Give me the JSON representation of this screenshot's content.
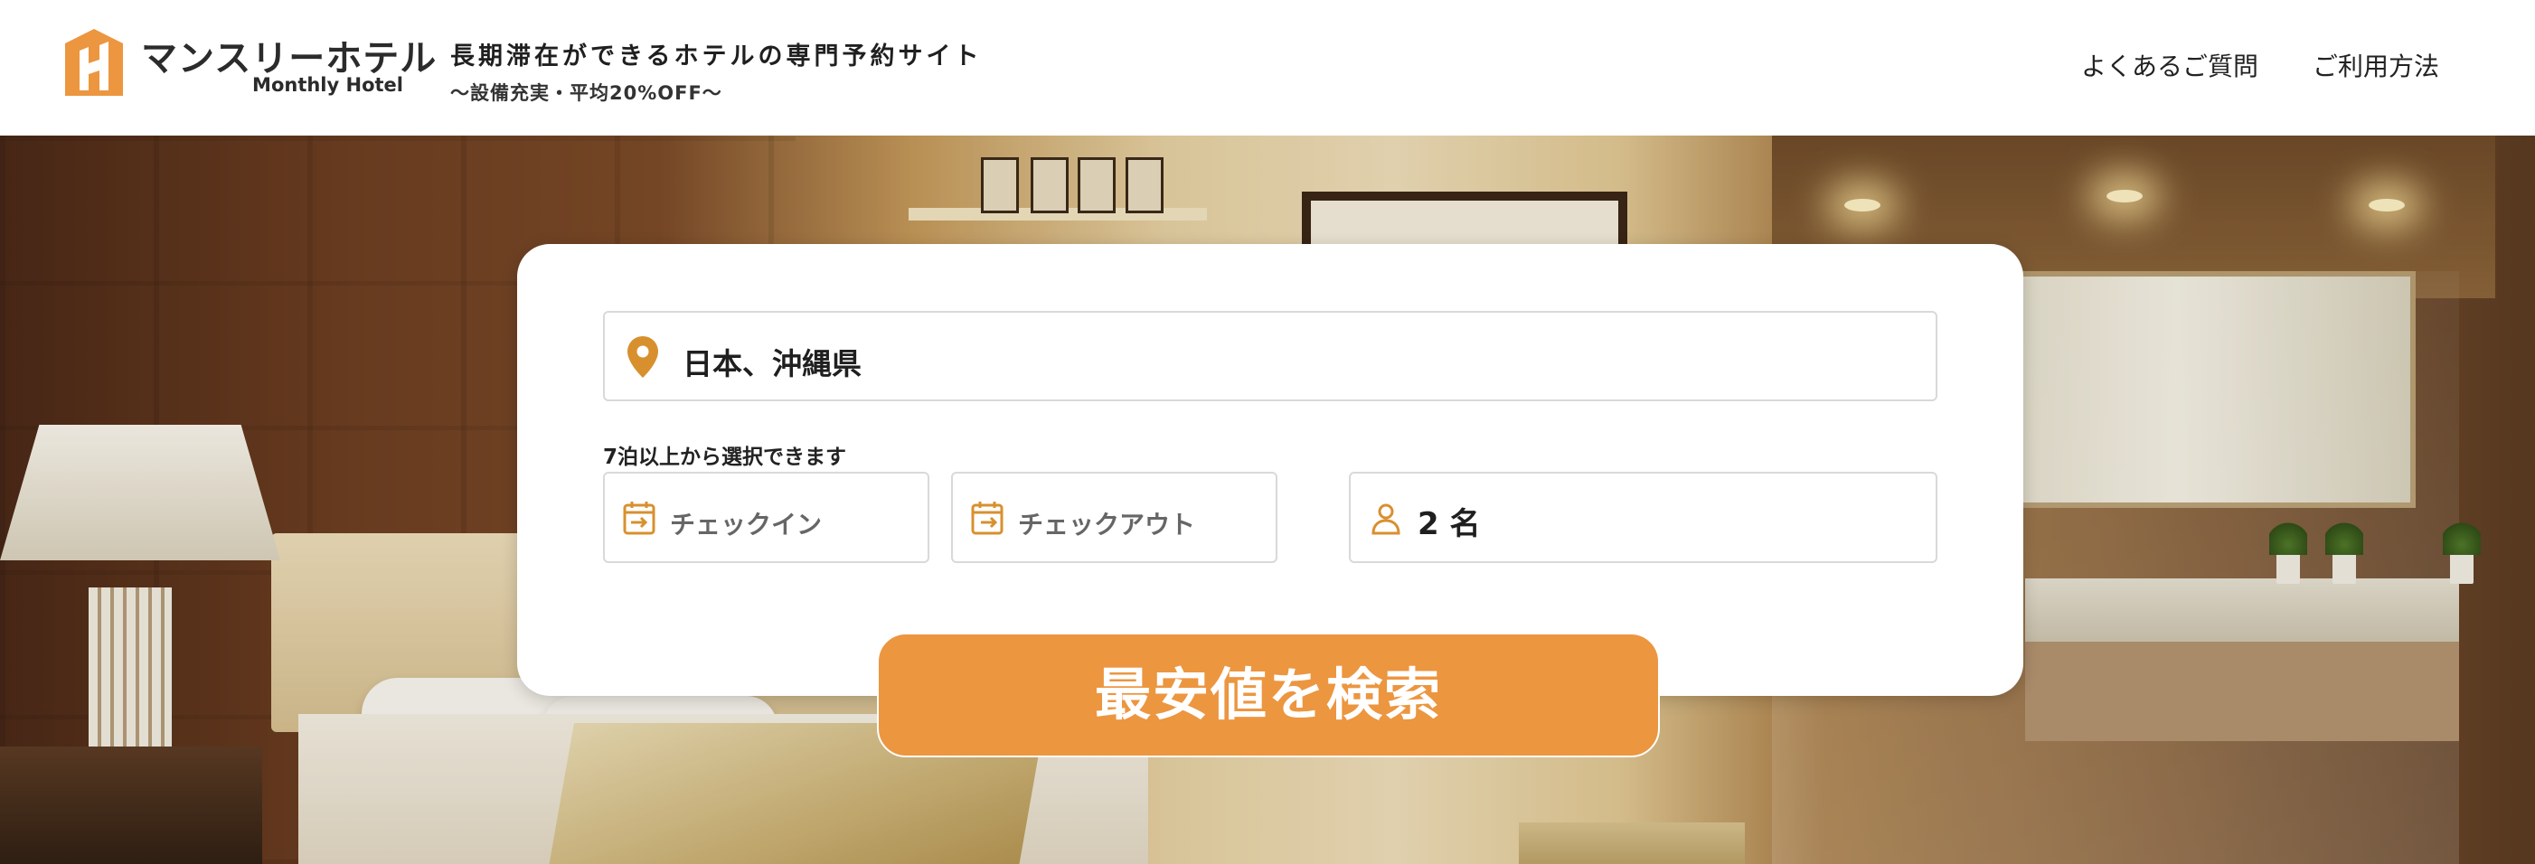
{
  "brand": {
    "name_jp": "マンスリーホテル",
    "name_en": "Monthly Hotel",
    "accent_color": "#ec9640",
    "logo_icon": "hotel-h-logo-icon"
  },
  "header": {
    "tagline": "長期滞在ができるホテルの専門予約サイト",
    "subtagline": "〜設備充実・平均20%OFF〜",
    "nav": [
      {
        "label": "よくあるご質問"
      },
      {
        "label": "ご利用方法"
      }
    ]
  },
  "search": {
    "location": {
      "value": "日本、沖縄県",
      "icon": "map-pin-icon"
    },
    "date_hint": "7泊以上から選択できます",
    "checkin": {
      "placeholder": "チェックイン",
      "icon": "calendar-checkin-icon"
    },
    "checkout": {
      "placeholder": "チェックアウト",
      "icon": "calendar-checkout-icon"
    },
    "guests": {
      "value": "2 名",
      "icon": "person-icon"
    },
    "button_label": "最安値を検索"
  }
}
